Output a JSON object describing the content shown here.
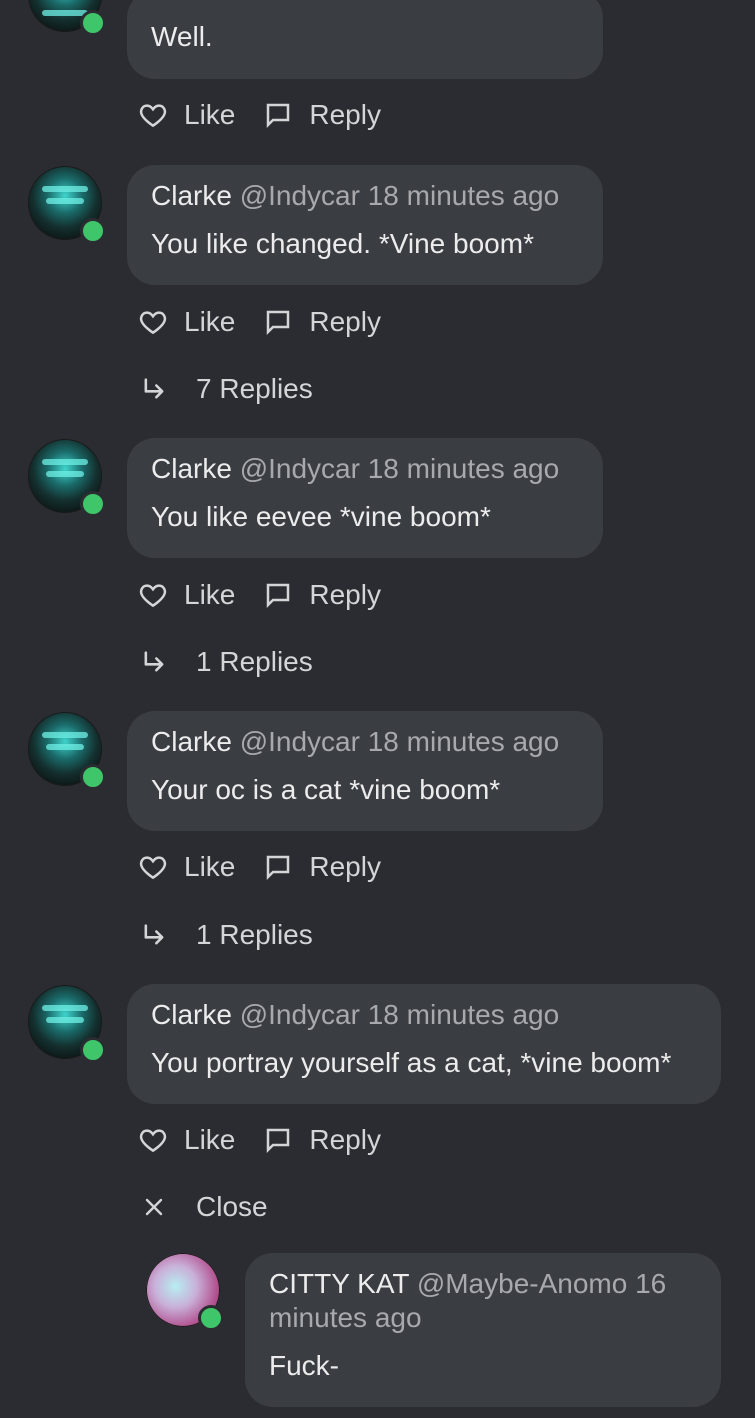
{
  "top_comment": {
    "body": "Well."
  },
  "actions": {
    "like": "Like",
    "reply": "Reply"
  },
  "comments": [
    {
      "name": "Clarke",
      "handle": "@Indycar",
      "time": "18 minutes ago",
      "body": "You like changed. *Vine boom*",
      "replies": "7 Replies"
    },
    {
      "name": "Clarke",
      "handle": "@Indycar",
      "time": "18 minutes ago",
      "body": "You like eevee *vine boom*",
      "replies": "1 Replies"
    },
    {
      "name": "Clarke",
      "handle": "@Indycar",
      "time": "18 minutes ago",
      "body": "Your oc is a cat *vine boom*",
      "replies": "1 Replies"
    },
    {
      "name": "Clarke",
      "handle": "@Indycar",
      "time": "18 minutes ago",
      "body": "You portray yourself as a cat, *vine boom*"
    }
  ],
  "close_label": "Close",
  "reply": {
    "name": "CITTY KAT",
    "handle": "@Maybe-Anomo",
    "time_line1": "16",
    "time_line2": "minutes ago",
    "body": "Fuck-"
  },
  "icons": {
    "like": "heart-icon",
    "reply": "comment-icon",
    "replies": "reply-arrow-icon",
    "close": "close-icon"
  },
  "colors": {
    "background": "#2a2c31",
    "bubble": "#3a3d42",
    "online": "#3fc66a",
    "muted": "#a7a9ad"
  }
}
